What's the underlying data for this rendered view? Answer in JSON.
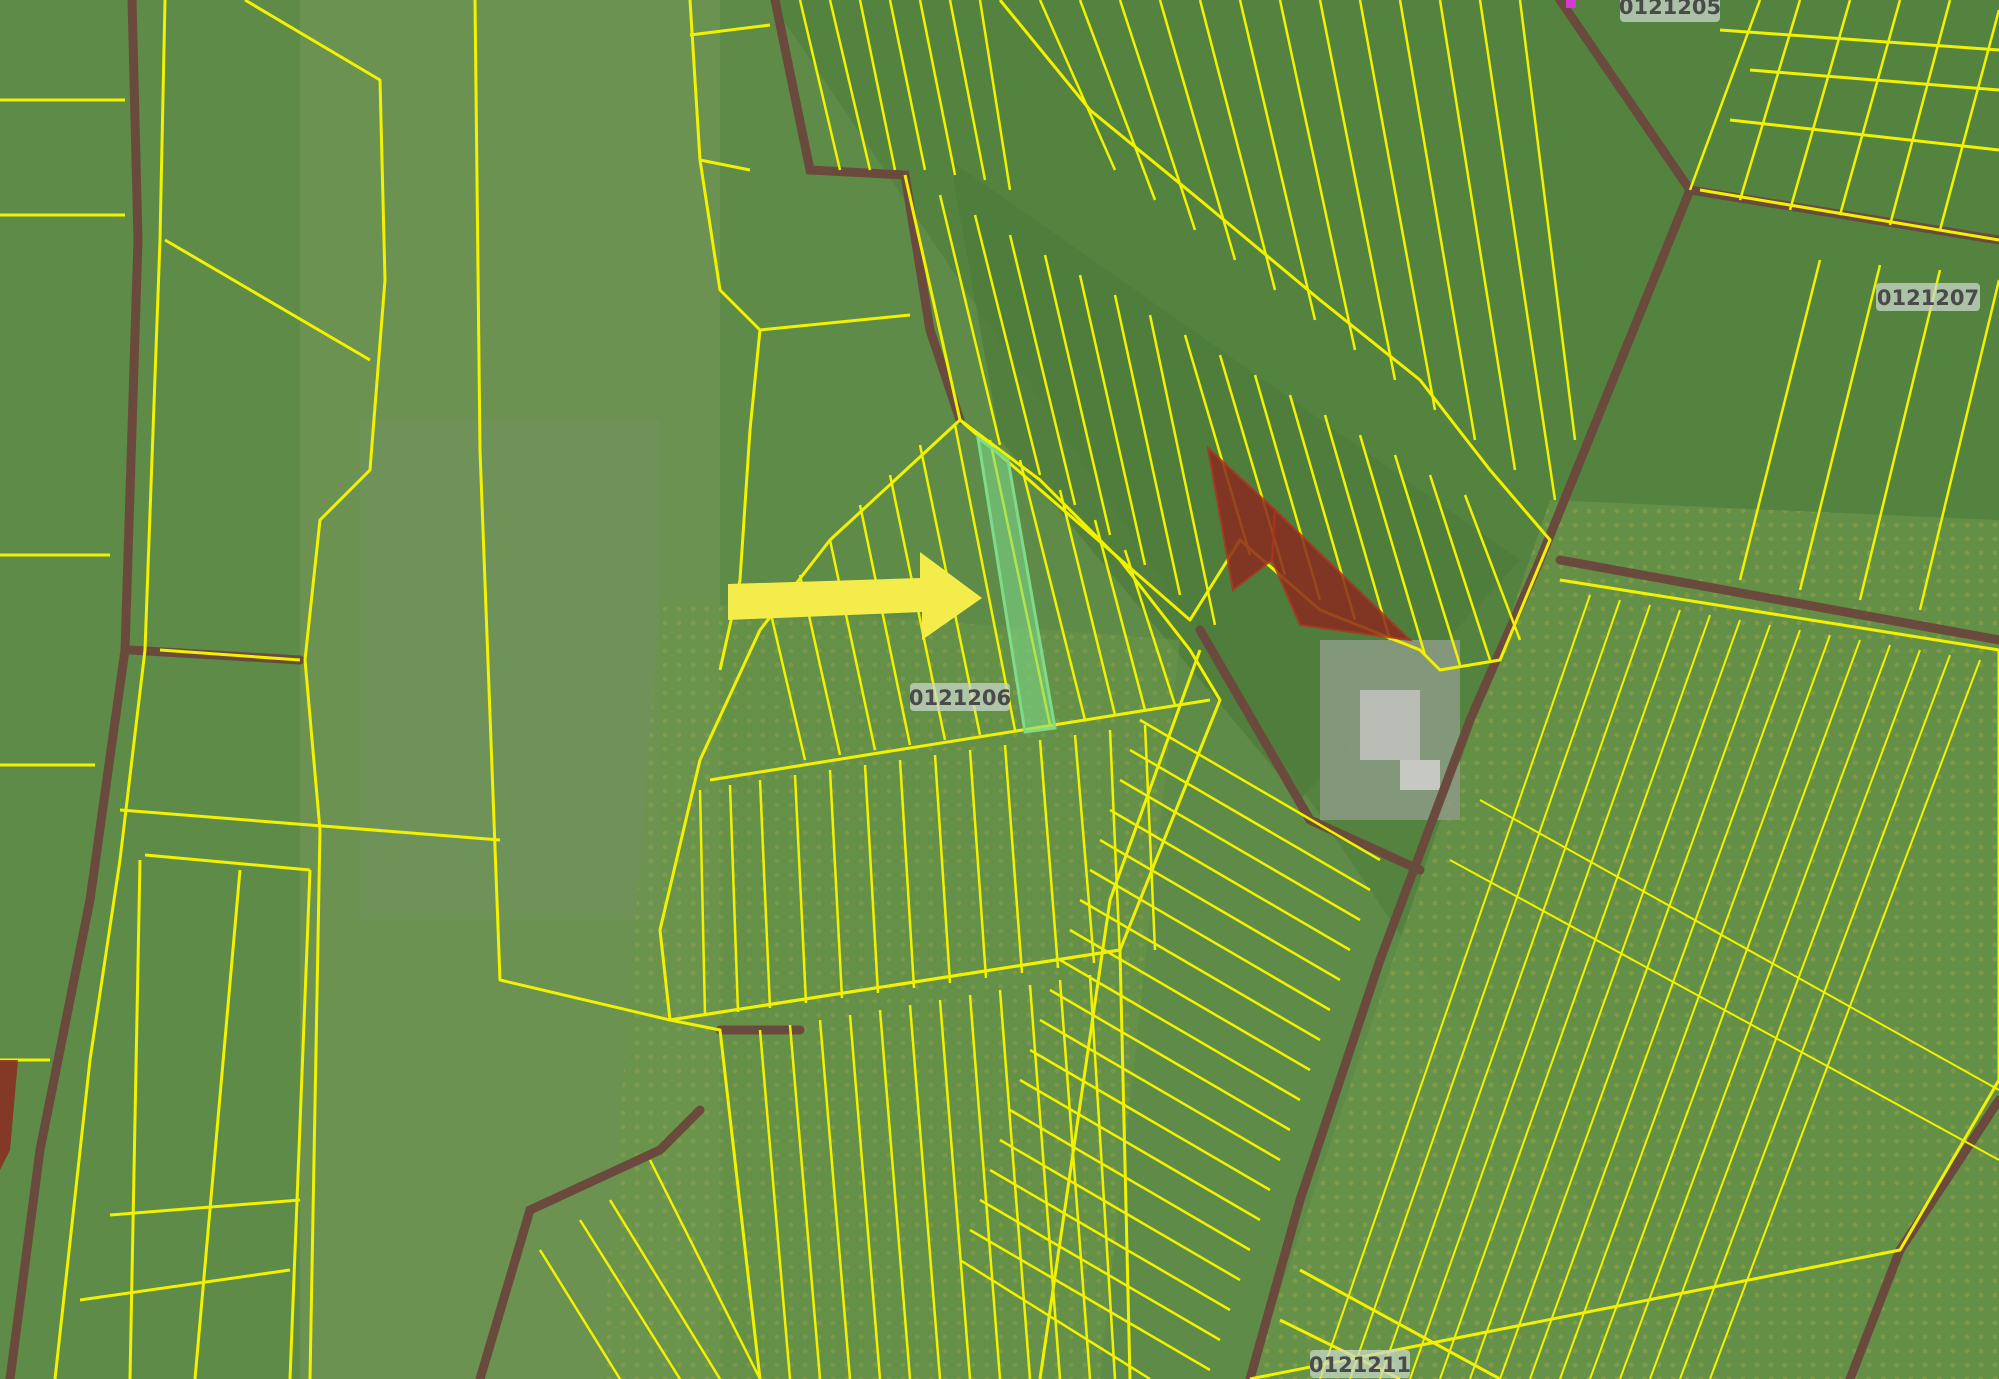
{
  "map": {
    "zone_labels": [
      {
        "id": "z205",
        "text": "0121205"
      },
      {
        "id": "z206",
        "text": "0121206"
      },
      {
        "id": "z207",
        "text": "0121207"
      },
      {
        "id": "z211",
        "text": "0121211"
      }
    ],
    "colors": {
      "parcel_outline": "#f2f200",
      "selected_parcel": "#7ddb8a",
      "flagged_parcel": "#8a2a20",
      "pointer_arrow": "#f4ec4a",
      "road": "#6b4a3e"
    },
    "markers": {
      "pointer": "arrow-pointing-right-to-selected-parcel",
      "selected": "selected-parcel-highlight"
    }
  }
}
